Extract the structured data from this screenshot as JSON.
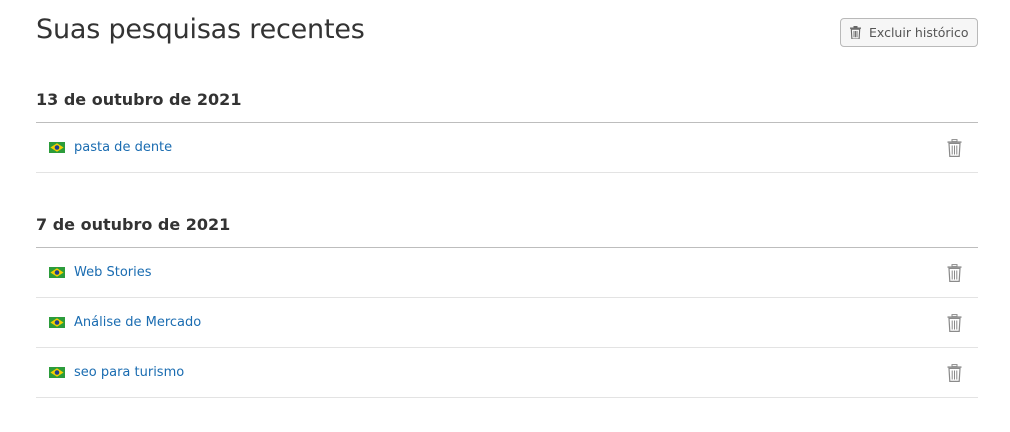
{
  "header": {
    "title": "Suas pesquisas recentes",
    "clear_button_label": "Excluir histórico"
  },
  "groups": [
    {
      "date": "13 de outubro de 2021",
      "items": [
        {
          "flag": "brazil-flag-icon",
          "label": "pasta de dente"
        }
      ]
    },
    {
      "date": "7 de outubro de 2021",
      "items": [
        {
          "flag": "brazil-flag-icon",
          "label": "Web Stories"
        },
        {
          "flag": "brazil-flag-icon",
          "label": "Análise de Mercado"
        },
        {
          "flag": "brazil-flag-icon",
          "label": "seo para turismo"
        }
      ]
    }
  ],
  "icons": {
    "delete": "trash-icon",
    "flag": "brazil-flag-icon"
  },
  "colors": {
    "link": "#1a6cb1",
    "flag_green": "#2c9c3b",
    "flag_yellow": "#f5d000",
    "flag_blue": "#1e3f8f"
  }
}
